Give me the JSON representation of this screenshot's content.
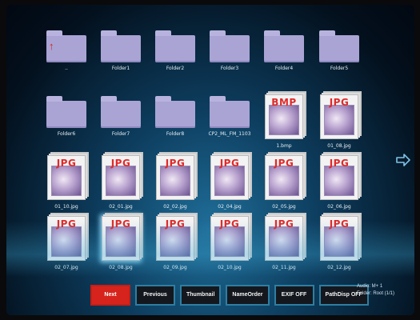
{
  "grid_items": [
    {
      "type": "folder",
      "label": "..",
      "icon": "up-arrow-icon"
    },
    {
      "type": "folder",
      "label": "Folder1"
    },
    {
      "type": "folder",
      "label": "Folder2"
    },
    {
      "type": "folder",
      "label": "Folder3"
    },
    {
      "type": "folder",
      "label": "Folder4"
    },
    {
      "type": "folder",
      "label": "Folder5"
    },
    {
      "type": "folder",
      "label": "Folder6"
    },
    {
      "type": "folder",
      "label": "Folder7"
    },
    {
      "type": "folder",
      "label": "Folder8"
    },
    {
      "type": "folder",
      "label": "CP2_ML_FM_1103"
    },
    {
      "type": "image",
      "format": "BMP",
      "label": "1.bmp"
    },
    {
      "type": "image",
      "format": "JPG",
      "label": "01_08.jpg"
    },
    {
      "type": "image",
      "format": "JPG",
      "label": "01_10.jpg"
    },
    {
      "type": "image",
      "format": "JPG",
      "label": "02_01.jpg"
    },
    {
      "type": "image",
      "format": "JPG",
      "label": "02_02.jpg"
    },
    {
      "type": "image",
      "format": "JPG",
      "label": "02_04.jpg"
    },
    {
      "type": "image",
      "format": "JPG",
      "label": "02_05.jpg"
    },
    {
      "type": "image",
      "format": "JPG",
      "label": "02_06.jpg"
    },
    {
      "type": "image",
      "format": "JPG",
      "label": "02_07.jpg"
    },
    {
      "type": "image",
      "format": "JPG",
      "label": "02_08.jpg",
      "selected": true
    },
    {
      "type": "image",
      "format": "JPG",
      "label": "02_09.jpg"
    },
    {
      "type": "image",
      "format": "JPG",
      "label": "02_10.jpg"
    },
    {
      "type": "image",
      "format": "JPG",
      "label": "02_11.jpg"
    },
    {
      "type": "image",
      "format": "JPG",
      "label": "02_12.jpg"
    }
  ],
  "buttons": [
    "Next",
    "Previous",
    "Thumbnail",
    "NameOrder",
    "EXIF OFF",
    "PathDisp OFF"
  ],
  "active_button": "Next",
  "info": {
    "line1": "Audio:  M+ 1",
    "line2": "Folder: Root (1/1)"
  },
  "colors": {
    "accent": "#d6241c",
    "button_border": "#2e7ea2",
    "folder": "#a9a4d4",
    "format_text": "#e12a2a"
  }
}
